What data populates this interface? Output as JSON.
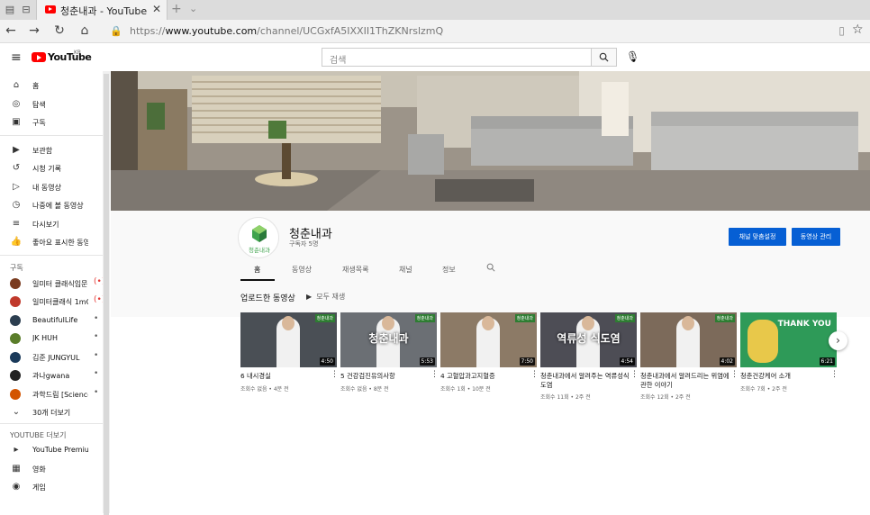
{
  "browser": {
    "tab_title": "청춘내과 - YouTube",
    "url_prefix": "https://",
    "url_host": "www.youtube.com",
    "url_path": "/channel/UCGxfA5IXXII1ThZKNrslzmQ"
  },
  "header": {
    "logo_text": "YouTube",
    "region": "KR",
    "search_placeholder": "검색"
  },
  "sidebar": {
    "main": [
      {
        "label": "홈",
        "icon": "home-icon"
      },
      {
        "label": "탐색",
        "icon": "explore-icon"
      },
      {
        "label": "구독",
        "icon": "subscriptions-icon"
      }
    ],
    "library": [
      {
        "label": "보관함",
        "icon": "library-icon"
      },
      {
        "label": "시청 기록",
        "icon": "history-icon"
      },
      {
        "label": "내 동영상",
        "icon": "my-videos-icon"
      },
      {
        "label": "나중에 볼 동영상",
        "icon": "watch-later-icon"
      },
      {
        "label": "다시보기",
        "icon": "playlist-icon"
      },
      {
        "label": "좋아요 표시한 동영상",
        "icon": "thumbs-up-icon"
      }
    ],
    "subs_heading": "구독",
    "subscriptions": [
      {
        "label": "일미터 클래식입문...",
        "live": "(•)",
        "color": "#7a3b1f"
      },
      {
        "label": "일미터클래식 1mC...",
        "live": "(•)",
        "color": "#c0392b"
      },
      {
        "label": "BeautifulLife",
        "live": "•",
        "color": "#2c3e50"
      },
      {
        "label": "JK HUH",
        "live": "•",
        "color": "#5a7d2a"
      },
      {
        "label": "김준 JUNGYUL",
        "live": "•",
        "color": "#1a3a5a"
      },
      {
        "label": "과나gwana",
        "live": "•",
        "color": "#222222"
      },
      {
        "label": "과학드림 [Science ...",
        "live": "•",
        "color": "#d35400"
      }
    ],
    "show_more": "30개 더보기",
    "more_heading": "YOUTUBE 더보기",
    "more": [
      {
        "label": "YouTube Premium",
        "icon": "premium-icon"
      },
      {
        "label": "영화",
        "icon": "movies-icon"
      },
      {
        "label": "게임",
        "icon": "gaming-icon"
      }
    ]
  },
  "channel": {
    "name": "청춘내과",
    "subscribers": "구독자 5명",
    "logo_text": "청춘내과",
    "customize_button": "채널 맞춤설정",
    "manage_button": "동영상 관리",
    "tabs": [
      "홈",
      "동영상",
      "재생목록",
      "채널",
      "정보"
    ]
  },
  "uploads": {
    "title": "업로드한 동영상",
    "play_all": "모두 재생",
    "videos": [
      {
        "title": "6 내시경실",
        "meta": "조회수 없음 • 4분 전",
        "duration": "4:50",
        "thumb_text": "",
        "bg": "#4a4f55"
      },
      {
        "title": "5 건강검진유의사항",
        "meta": "조회수 없음 • 8분 전",
        "duration": "5:53",
        "thumb_text": "청춘내과",
        "bg": "#6b6f74"
      },
      {
        "title": "4 고혈압과고지혈증",
        "meta": "조회수 1회 • 10분 전",
        "duration": "7:50",
        "thumb_text": "",
        "bg": "#8c7a66"
      },
      {
        "title": "청춘내과에서 알려주는 역류성식도염",
        "meta": "조회수 11회 • 2주 전",
        "duration": "4:54",
        "thumb_text": "역류성 식도염",
        "bg": "#4d4d55"
      },
      {
        "title": "청춘내과에서 알려드리는 위염에 관한 이야기",
        "meta": "조회수 12회 • 2주 전",
        "duration": "4:02",
        "thumb_text": "",
        "bg": "#7c6a5a"
      },
      {
        "title": "청춘건강케어 소개",
        "meta": "조회수 7회 • 2주 전",
        "duration": "6:21",
        "thumb_text": "THANK YOU",
        "bg": "#2e9a58"
      }
    ]
  },
  "colors": {
    "brand_red": "#ff0000",
    "button_blue": "#065fd4"
  }
}
